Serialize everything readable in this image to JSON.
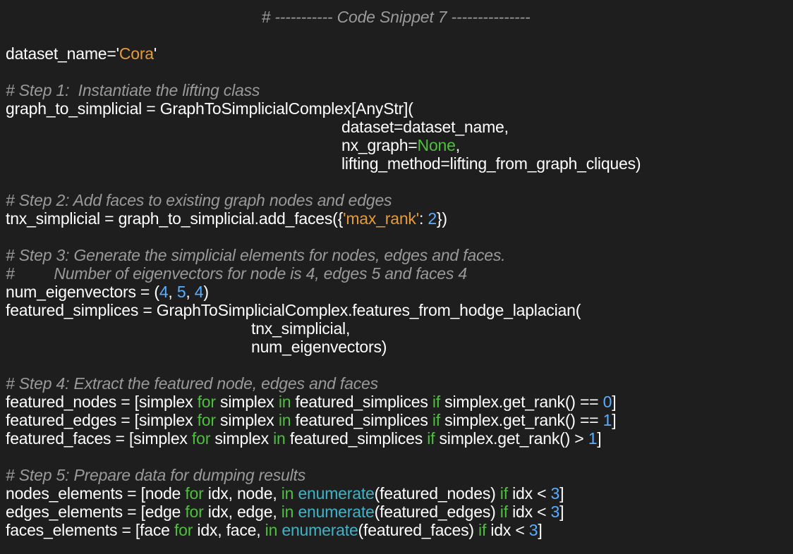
{
  "snippet_title": "# ----------- Code Snippet 7 ---------------",
  "lines": {
    "l1": {
      "a": "dataset_name=",
      "s1": "'",
      "s2": "Cora",
      "s3": "'"
    },
    "l2": {
      "c": "# Step 1:  Instantiate the lifting class"
    },
    "l3": {
      "a": "graph_to_simplicial = GraphToSimplicialComplex[AnyStr]("
    },
    "l4": {
      "a": "dataset=dataset_name,"
    },
    "l5": {
      "a": "nx_graph=",
      "k": "None",
      "b": ","
    },
    "l6": {
      "a": "lifting_method=lifting_from_graph_cliques)"
    },
    "l7": {
      "c": "# Step 2: Add faces to existing graph nodes and edges"
    },
    "l8": {
      "a": "tnx_simplicial = graph_to_simplicial.add_faces({",
      "s1": "'",
      "s2": "max_rank",
      "s3": "'",
      "b": ": ",
      "n": "2",
      "e": "})"
    },
    "l9": {
      "c": "# Step 3: Generate the simplicial elements for nodes, edges and faces."
    },
    "l10": {
      "c": "#         Number of eigenvectors for node is 4, edges 5 and faces 4"
    },
    "l11": {
      "a": "num_eigenvectors = (",
      "n1": "4",
      "b1": ", ",
      "n2": "5",
      "b2": ", ",
      "n3": "4",
      "e": ")"
    },
    "l12": {
      "a": "featured_simplices = GraphToSimplicialComplex.features_from_hodge_laplacian("
    },
    "l13": {
      "a": "tnx_simplicial,"
    },
    "l14": {
      "a": "num_eigenvectors)"
    },
    "l15": {
      "c": "# Step 4: Extract the featured node, edges and faces"
    },
    "l16": {
      "a": "featured_nodes = [simplex ",
      "k1": "for",
      "b1": " simplex ",
      "k2": "in",
      "b2": " featured_simplices ",
      "k3": "if",
      "b3": " simplex.get_rank() == ",
      "n": "0",
      "e": "]"
    },
    "l17": {
      "a": "featured_edges = [simplex ",
      "k1": "for",
      "b1": " simplex ",
      "k2": "in",
      "b2": " featured_simplices ",
      "k3": "if",
      "b3": " simplex.get_rank() == ",
      "n": "1",
      "e": "]"
    },
    "l18": {
      "a": "featured_faces = [simplex ",
      "k1": "for",
      "b1": " simplex ",
      "k2": "in",
      "b2": " featured_simplices ",
      "k3": "if",
      "b3": " simplex.get_rank() > ",
      "n": "1",
      "e": "]"
    },
    "l19": {
      "c": "# Step 5: Prepare data for dumping results"
    },
    "l20": {
      "a": "nodes_elements = [node ",
      "k1": "for",
      "b1": " idx, node, ",
      "k2": "in",
      "b2": " ",
      "f": "enumerate",
      "b3": "(featured_nodes) ",
      "k3": "if",
      "b4": " idx < ",
      "n": "3",
      "e": "]"
    },
    "l21": {
      "a": "edges_elements = [edge ",
      "k1": "for",
      "b1": " idx, edge, ",
      "k2": "in",
      "b2": " ",
      "f": "enumerate",
      "b3": "(featured_edges) ",
      "k3": "if",
      "b4": " idx < ",
      "n": "3",
      "e": "]"
    },
    "l22": {
      "a": "faces_elements = [face ",
      "k1": "for",
      "b1": " idx, face, ",
      "k2": "in",
      "b2": " ",
      "f": "enumerate",
      "b3": "(featured_faces) ",
      "k3": "if",
      "b4": " idx < ",
      "n": "3",
      "e": "]"
    }
  },
  "colors": {
    "background": "#1e1e1e",
    "text": "#ffffff",
    "comment": "#9a9a9a",
    "string": "#e59b3c",
    "number": "#5aaeff",
    "keyword": "#4fbf3f",
    "builtin": "#3fb3c7"
  }
}
